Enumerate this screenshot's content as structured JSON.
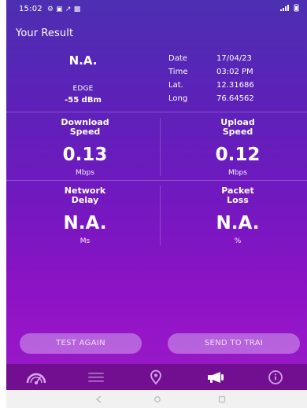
{
  "status_bar": {
    "time": "15:02",
    "notification_icons": "⚙ ▣ ↗ ▩"
  },
  "header": {
    "title": "Your Result"
  },
  "summary": {
    "network_type": "N.A.",
    "network_label": "EDGE",
    "signal_strength": "-55 dBm",
    "details": [
      {
        "label": "Date",
        "value": "17/04/23"
      },
      {
        "label": "Time",
        "value": "03:02 PM"
      },
      {
        "label": "Lat.",
        "value": "12.31686"
      },
      {
        "label": "Long",
        "value": "76.64562"
      }
    ]
  },
  "metrics": {
    "download": {
      "title_line1": "Download",
      "title_line2": "Speed",
      "value": "0.13",
      "unit": "Mbps"
    },
    "upload": {
      "title_line1": "Upload",
      "title_line2": "Speed",
      "value": "0.12",
      "unit": "Mbps"
    },
    "delay": {
      "title_line1": "Network",
      "title_line2": "Delay",
      "value": "N.A.",
      "unit": "Ms"
    },
    "packet_loss": {
      "title_line1": "Packet",
      "title_line2": "Loss",
      "value": "N.A.",
      "unit": "%"
    }
  },
  "buttons": {
    "test_again": "TEST AGAIN",
    "send_to_trai": "SEND TO TRAI"
  },
  "bottom_nav": [
    {
      "icon": "speedometer-icon"
    },
    {
      "icon": "list-icon"
    },
    {
      "icon": "location-pin-icon"
    },
    {
      "icon": "megaphone-icon"
    },
    {
      "icon": "info-icon"
    }
  ],
  "system_nav": [
    {
      "icon": "back-icon"
    },
    {
      "icon": "home-icon"
    },
    {
      "icon": "recent-apps-icon"
    }
  ],
  "colors": {
    "gradient_top": "#4d2fb1",
    "gradient_bottom": "#9b1ac8",
    "button_fill": "#c580e6",
    "bottom_nav_bg": "#720f91",
    "system_nav_bg": "#f1f1f1"
  }
}
